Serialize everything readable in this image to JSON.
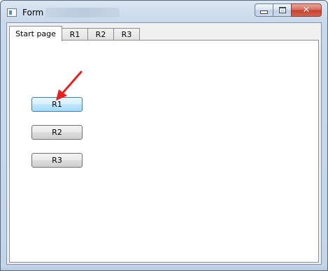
{
  "window": {
    "title": "Form",
    "controls": {
      "minimize": "minimize-icon",
      "maximize": "maximize-icon",
      "close": "✕"
    }
  },
  "tabs": [
    {
      "label": "Start page",
      "active": true
    },
    {
      "label": "R1",
      "active": false
    },
    {
      "label": "R2",
      "active": false
    },
    {
      "label": "R3",
      "active": false
    }
  ],
  "buttons": {
    "r1": "R1",
    "r2": "R2",
    "r3": "R3"
  },
  "annotation": {
    "arrow_color": "#e8201e"
  }
}
